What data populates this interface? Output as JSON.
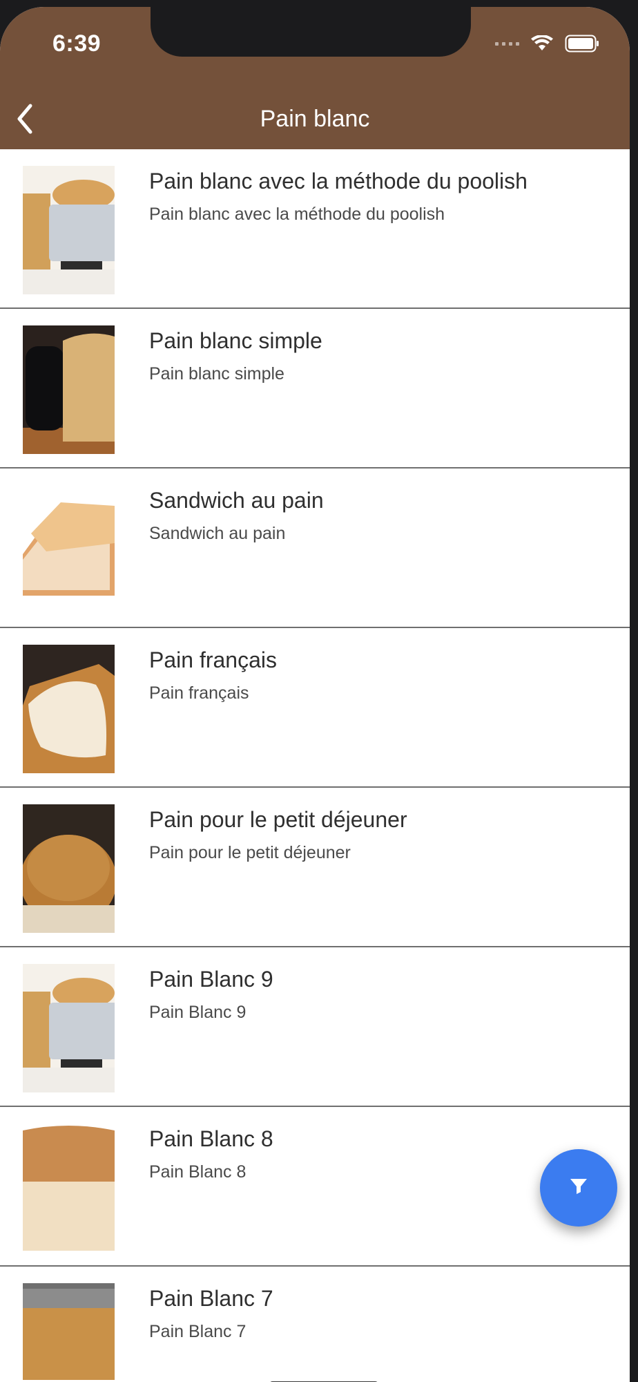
{
  "status": {
    "time": "6:39"
  },
  "nav": {
    "title": "Pain blanc"
  },
  "items": [
    {
      "title": "Pain blanc avec la méthode du poolish",
      "subtitle": "Pain blanc avec la méthode du poolish"
    },
    {
      "title": "Pain blanc simple",
      "subtitle": "Pain blanc simple"
    },
    {
      "title": "Sandwich au pain",
      "subtitle": "Sandwich au pain"
    },
    {
      "title": "Pain français",
      "subtitle": "Pain français"
    },
    {
      "title": "Pain pour le petit déjeuner",
      "subtitle": "Pain pour le petit déjeuner"
    },
    {
      "title": "Pain Blanc 9",
      "subtitle": "Pain Blanc 9"
    },
    {
      "title": "Pain Blanc 8",
      "subtitle": "Pain Blanc 8"
    },
    {
      "title": "Pain Blanc 7",
      "subtitle": "Pain Blanc 7"
    }
  ],
  "colors": {
    "header": "#74513a",
    "fab": "#3b7cf0"
  },
  "icons": {
    "back": "chevron-left-icon",
    "filter": "filter-icon"
  }
}
